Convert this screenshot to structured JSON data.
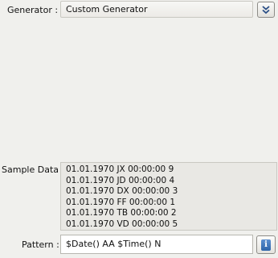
{
  "generator": {
    "label": "Generator :",
    "value": "Custom Generator",
    "dropdown_icon": "double-chevron-down-icon"
  },
  "sample_data": {
    "label": "Sample Data :",
    "lines": [
      "01.01.1970 JX 00:00:00 9",
      "01.01.1970 JD 00:00:00 4",
      "01.01.1970 DX 00:00:00 3",
      "01.01.1970 FF 00:00:00 1",
      "01.01.1970 TB 00:00:00 2",
      "01.01.1970 VD 00:00:00 5"
    ]
  },
  "pattern": {
    "label": "Pattern :",
    "value": "$Date() AA $Time() N",
    "info_icon": "info-icon"
  }
}
